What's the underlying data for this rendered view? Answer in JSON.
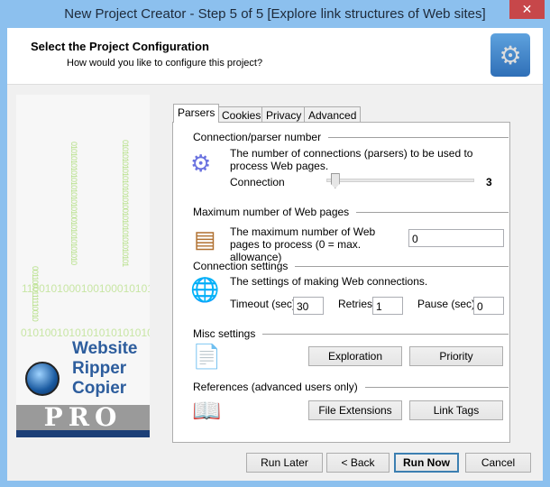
{
  "window": {
    "title": "New Project Creator - Step 5 of 5 [Explore link structures of Web sites]",
    "close_glyph": "✕"
  },
  "header": {
    "title": "Select the Project Configuration",
    "subtitle": "How would you like to configure this project?",
    "icon": "gears-icon"
  },
  "logo": {
    "line1": "Website",
    "line2": "Ripper",
    "line3": "Copier",
    "badge": "PRO"
  },
  "tabs": [
    {
      "label": "Parsers",
      "active": true
    },
    {
      "label": "Cookies"
    },
    {
      "label": "Privacy"
    },
    {
      "label": "Advanced"
    }
  ],
  "connection": {
    "heading": "Connection/parser number",
    "description": "The number of connections (parsers) to be used to process Web pages.",
    "slider_label": "Connection",
    "value": "3",
    "slider_fraction": 0.2
  },
  "max_pages": {
    "heading": "Maximum number of Web pages",
    "description": "The maximum number of Web pages to process (0 = max. allowance)",
    "value": "0"
  },
  "conn_settings": {
    "heading": "Connection settings",
    "description": "The settings of making Web connections.",
    "timeout_label": "Timeout (sec)",
    "timeout": "30",
    "retries_label": "Retries:",
    "retries": "1",
    "pause_label": "Pause (sec):",
    "pause": "0"
  },
  "misc": {
    "heading": "Misc settings",
    "exploration": "Exploration",
    "priority": "Priority"
  },
  "references": {
    "heading": "References (advanced users only)",
    "file_extensions": "File Extensions",
    "link_tags": "Link Tags"
  },
  "footer": {
    "run_later": "Run Later",
    "back": "< Back",
    "run_now": "Run Now",
    "cancel": "Cancel"
  }
}
